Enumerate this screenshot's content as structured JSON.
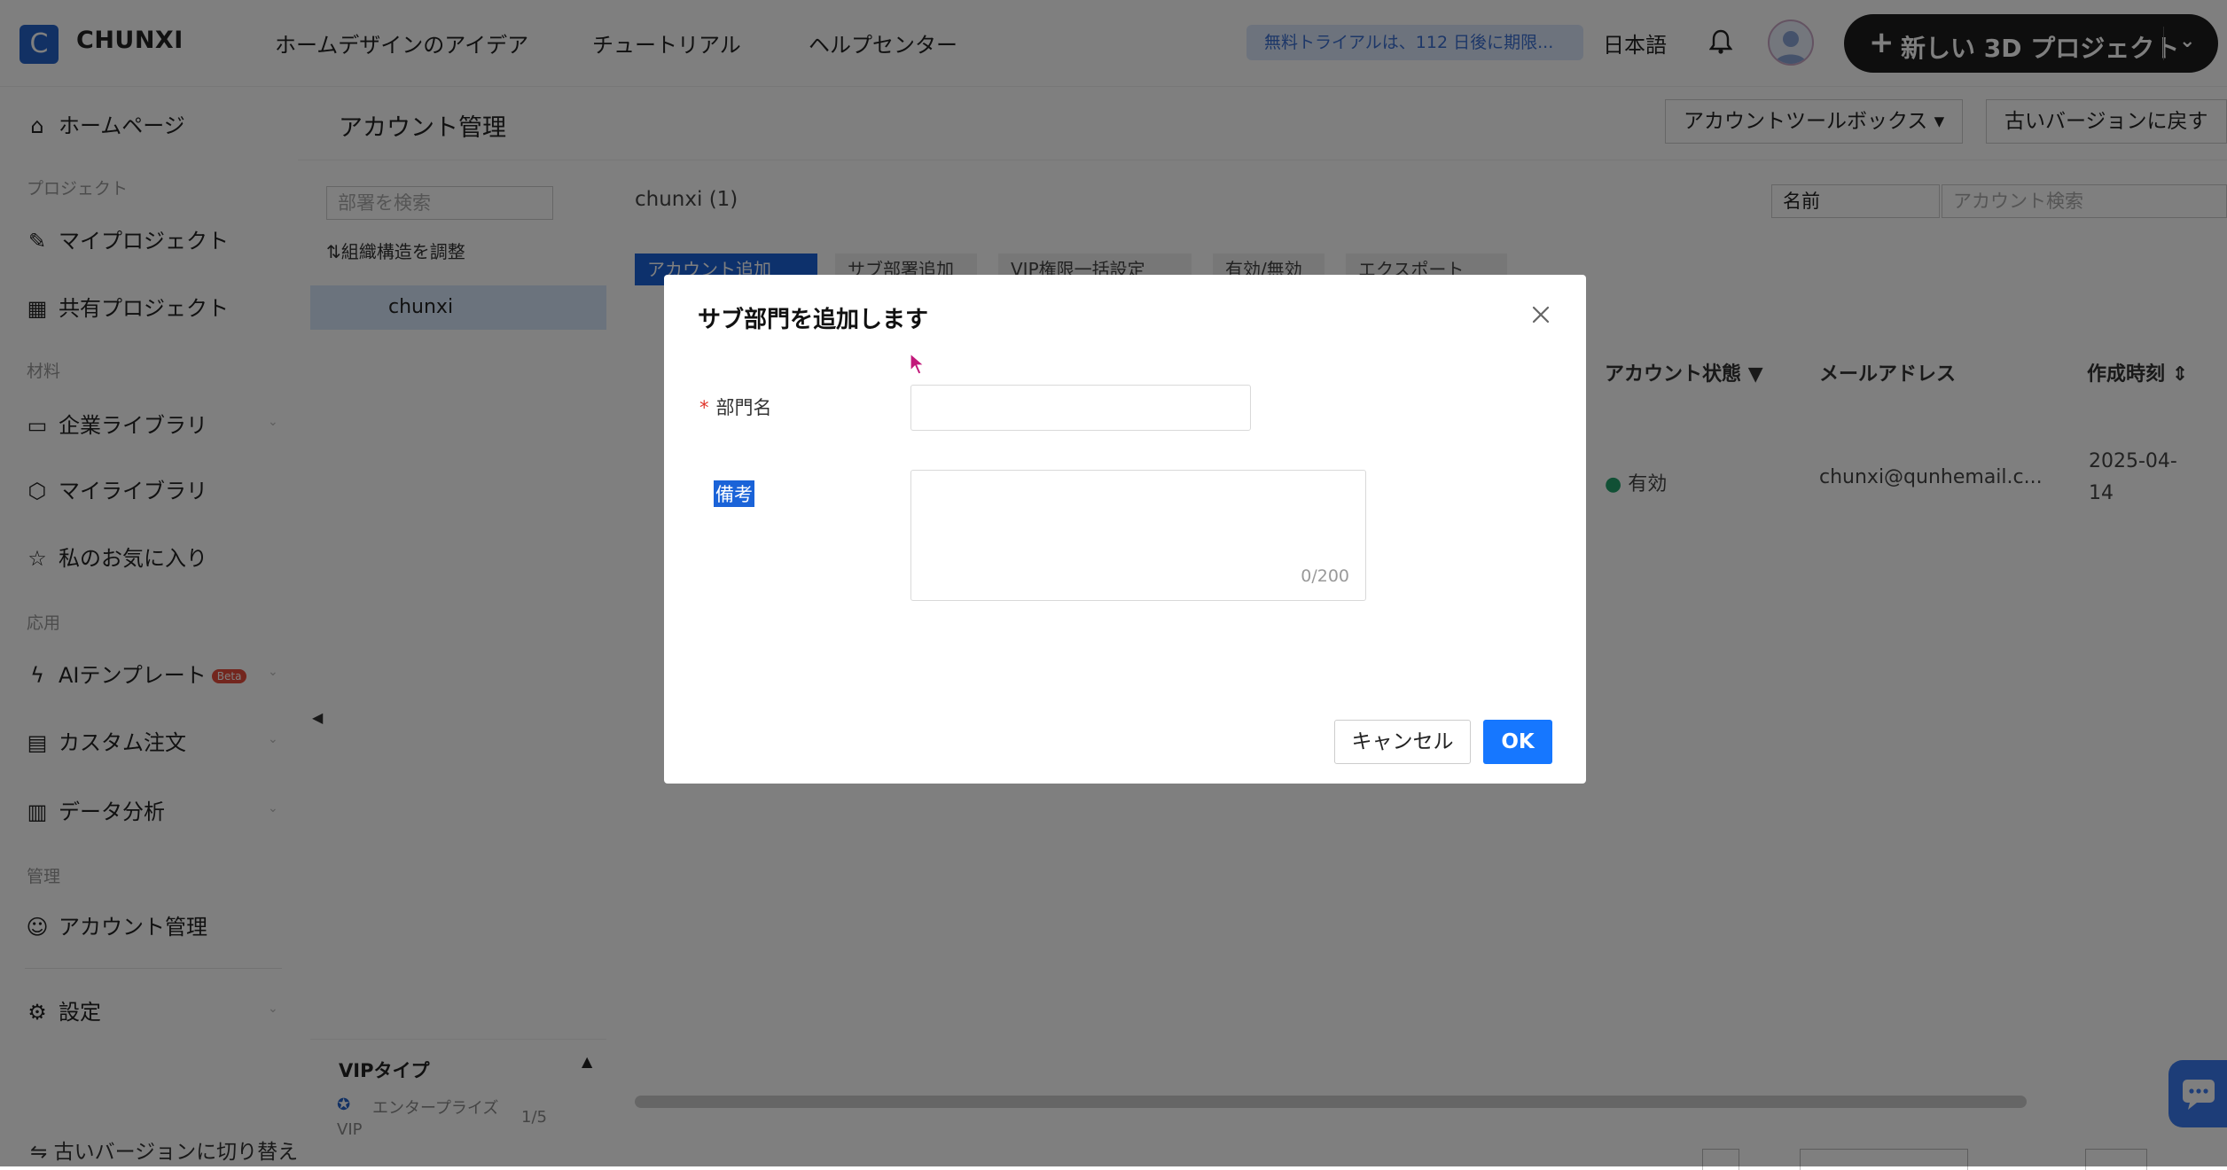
{
  "header": {
    "logo_letter": "C",
    "app_name": "CHUNXI",
    "nav": [
      "ホームデザインのアイデア",
      "チュートリアル",
      "ヘルプセンター"
    ],
    "trial_notice": "無料トライアルは、112 日後に期限...",
    "language": "日本語",
    "new_project_label": "新しい 3D プロジェクト"
  },
  "sidebar": {
    "home": "ホームページ",
    "sec_project": "プロジェクト",
    "my_projects": "マイプロジェクト",
    "shared_projects": "共有プロジェクト",
    "sec_materials": "材料",
    "enterprise_library": "企業ライブラリ",
    "my_library": "マイライブラリ",
    "favorites": "私のお気に入り",
    "sec_apps": "応用",
    "ai_templates": "AIテンプレート",
    "beta": "Beta",
    "custom_orders": "カスタム注文",
    "data_analysis": "データ分析",
    "sec_manage": "管理",
    "account_management": "アカウント管理",
    "settings": "設定",
    "old_version_switch": "古いバージョンに切り替え"
  },
  "main": {
    "page_title": "アカウント管理",
    "account_toolbox": "アカウントツールボックス",
    "revert_old_version": "古いバージョンに戻す",
    "dept_search_placeholder": "部署を検索",
    "adjust_org": "組織構造を調整",
    "selected_dept": "chunxi",
    "dept_count_title": "chunxi (1)",
    "filter_select": "名前",
    "account_search_placeholder": "アカウント検索",
    "toolbar": [
      "アカウント追加",
      "サブ部署追加",
      "VIP権限一括設定",
      "有効/無効",
      "エクスポート"
    ],
    "columns": [
      "アカウント状態",
      "メールアドレス",
      "作成時刻"
    ],
    "row": {
      "status": "有効",
      "email": "chunxi@qunhemail.c...",
      "created_date": "2025-04-",
      "created_time": "14"
    },
    "vip_type_title": "VIPタイプ",
    "vip_name_line1": "エンタープライズ",
    "vip_name_line2": "VIP",
    "vip_count": "1/5"
  },
  "modal": {
    "title": "サブ部門を追加します",
    "dept_name_label": "部門名",
    "required_mark": "*",
    "dept_name_value": "",
    "remarks_label": "備考",
    "remarks_value": "",
    "remarks_counter": "0/200",
    "cancel_label": "キャンセル",
    "ok_label": "OK"
  },
  "colors": {
    "primary": "#1677ff",
    "overlay": "rgba(0,0,0,0.5)",
    "status_active": "#22a06b",
    "selection_highlight": "#1a63d8"
  }
}
